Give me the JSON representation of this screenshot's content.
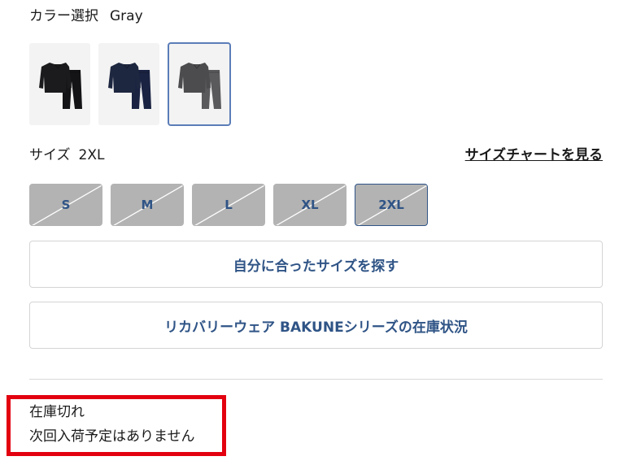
{
  "color": {
    "label": "カラー選択",
    "value": "Gray",
    "swatches": [
      {
        "name": "Black",
        "top_color": "#1b1b1d",
        "bottom_color": "#141416",
        "selected": false
      },
      {
        "name": "Navy",
        "top_color": "#1e2740",
        "bottom_color": "#1a2342",
        "selected": false
      },
      {
        "name": "Gray",
        "top_color": "#4c4c4e",
        "bottom_color": "#5a5a5c",
        "selected": true
      }
    ]
  },
  "size": {
    "label": "サイズ",
    "value": "2XL",
    "chart_link": "サイズチャートを見る",
    "options": [
      "S",
      "M",
      "L",
      "XL",
      "2XL"
    ],
    "selected": "2XL"
  },
  "buttons": {
    "find_size": "自分に合ったサイズを探す",
    "stock_status": "リカバリーウェア BAKUNEシリーズの在庫状況"
  },
  "stock": {
    "status": "在庫切れ",
    "note": "次回入荷予定はありません"
  },
  "colors": {
    "accent": "#2f5486",
    "disabled_bg": "#b3b3b3",
    "highlight_box": "#e3000f",
    "swatch_selected_border": "#5b7db8"
  }
}
